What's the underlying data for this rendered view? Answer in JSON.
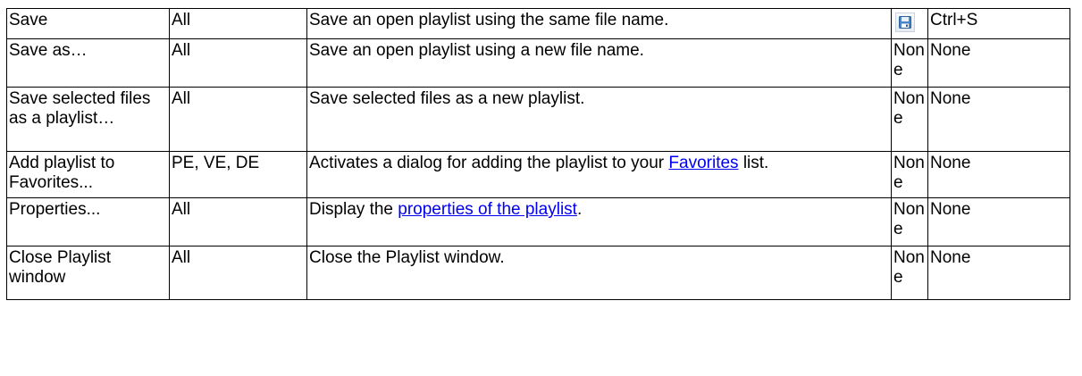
{
  "rows": [
    {
      "command": "Save",
      "editions": "All",
      "desc_before": "Save an open playlist using the same file name.",
      "link": "",
      "desc_after": "",
      "icon": "floppy-disk-save-icon",
      "button": "",
      "shortcut": "Ctrl+S"
    },
    {
      "command": "Save as…",
      "editions": "All",
      "desc_before": "Save an open playlist using a new file name.",
      "link": "",
      "desc_after": "",
      "button": "None",
      "shortcut": "None"
    },
    {
      "command": "Save selected files as a playlist…",
      "editions": "All",
      "desc_before": "Save selected files as a new playlist.",
      "link": "",
      "desc_after": "",
      "button": "None",
      "shortcut": "None"
    },
    {
      "command": "Add playlist to Favorites...",
      "editions": "PE, VE, DE",
      "desc_before": "Activates a dialog for adding the playlist to your ",
      "link": "Favorites",
      "desc_after": " list.",
      "button": "None",
      "shortcut": "None"
    },
    {
      "command": "Properties...",
      "editions": "All",
      "desc_before": "Display the ",
      "link": "properties of the playlist",
      "desc_after": ".",
      "button": "None",
      "shortcut": "None"
    },
    {
      "command": "Close Playlist window",
      "editions": "All",
      "desc_before": "Close the Playlist window.",
      "link": "",
      "desc_after": "",
      "button": "None",
      "shortcut": "None"
    }
  ]
}
